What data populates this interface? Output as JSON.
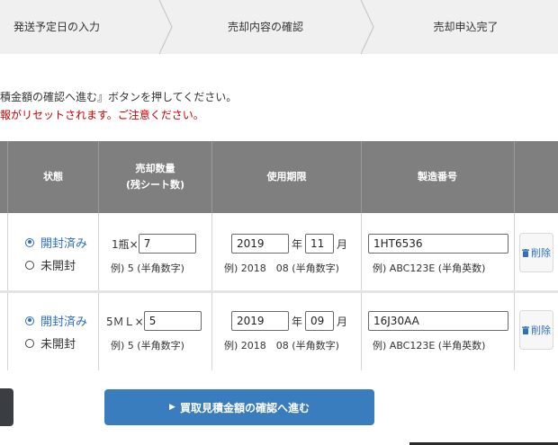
{
  "steps": {
    "step1": "発送予定日の入力",
    "step2": "売却内容の確認",
    "step3": "売却申込完了"
  },
  "notices": {
    "line1": "積金額の確認へ進む』ボタンを押してください。",
    "line2": "報がリセットされます。ご注意ください。"
  },
  "table": {
    "headers": {
      "status": "状態",
      "quantity_line1": "売却数量",
      "quantity_line2": "(残シート数)",
      "expiry": "使用期限",
      "serial": "製造番号"
    },
    "rows": [
      {
        "status_opened": "開封済み",
        "status_unopened": "未開封",
        "quantity_prefix": "1瓶×",
        "quantity_value": "7",
        "quantity_example": "例) 5 (半角数字)",
        "expiry_year": "2019",
        "year_unit": "年",
        "expiry_month": "11",
        "month_unit": "月",
        "expiry_example": "例) 2018　08 (半角数字)",
        "serial_value": "1HT6536",
        "serial_example": "例) ABC123E (半角英数)",
        "delete_label": "削除"
      },
      {
        "status_opened": "開封済み",
        "status_unopened": "未開封",
        "quantity_prefix": "5ＭＬ×",
        "quantity_value": "5",
        "quantity_example": "例) 5 (半角数字)",
        "expiry_year": "2019",
        "year_unit": "年",
        "expiry_month": "09",
        "month_unit": "月",
        "expiry_example": "例) 2018　08 (半角数字)",
        "serial_value": "16J30AA",
        "serial_example": "例) ABC123E (半角英数)",
        "delete_label": "削除"
      }
    ]
  },
  "buttons": {
    "next_label": "買取見積金額の確認へ進む",
    "next_icon": "caret-right-icon"
  },
  "colors": {
    "accent": "#3a7dbf",
    "header_bg": "#7f7f7f",
    "warning": "#cc0000",
    "selected_radio": "#2f6fc0"
  }
}
